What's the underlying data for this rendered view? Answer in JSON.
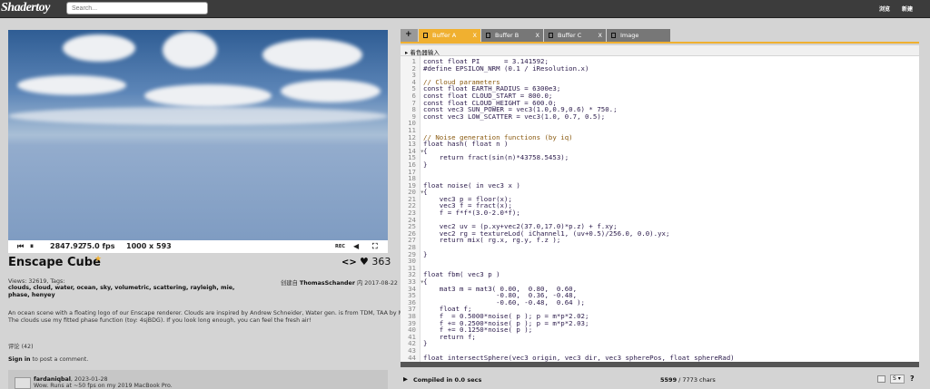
{
  "header": {
    "logo": "Shadertoy",
    "search_placeholder": "Search...",
    "nav": [
      "浏览",
      "新建"
    ]
  },
  "player": {
    "time": "2847.92",
    "fps": "75.0 fps",
    "resolution": "1000 x 593",
    "rec": "REC"
  },
  "shader": {
    "title": "Enscape Cube",
    "likes": "363",
    "views": "Views: 32619, Tags:",
    "tags": "clouds, cloud, water, ocean, sky, volumetric, scattering, rayleigh, mie, phase, henyey",
    "created_prefix": "创建自",
    "author": "ThomasSchander",
    "created_suffix": "内 2017-08-22",
    "description1": "An ocean scene with a floating logo of our Enscape renderer. Clouds are inspired by Andrew Schneider, Water gen. is from TDM, TAA by Marco Salvi.",
    "description2": "The clouds use my fitted phase function (toy: 4sjBDG). If you look long enough, you can feel the fresh air!"
  },
  "comments": {
    "count_label": "评论 (42)",
    "sign_in": "Sign in",
    "sign_in_suffix": " to post a comment.",
    "items": [
      {
        "user": "fardaniqbal",
        "date": ", 2023-01-28",
        "text": "Wow. Runs at ~50 fps on my 2019 MacBook Pro."
      }
    ]
  },
  "editor": {
    "tabs": [
      {
        "label": "Buffer A",
        "active": true
      },
      {
        "label": "Buffer B"
      },
      {
        "label": "Buffer C"
      },
      {
        "label": "Image"
      }
    ],
    "close": "X",
    "add": "+",
    "inputs_label": "着色器输入",
    "lines": [
      "const float PI      = 3.141592;",
      "#define EPSILON_NRM (0.1 / iResolution.x)",
      "",
      "// Cloud parameters",
      "const float EARTH_RADIUS = 6300e3;",
      "const float CLOUD_START = 800.0;",
      "const float CLOUD_HEIGHT = 600.0;",
      "const vec3 SUN_POWER = vec3(1.0,0.9,0.6) * 750.;",
      "const vec3 LOW_SCATTER = vec3(1.0, 0.7, 0.5);",
      "",
      "",
      "// Noise generation functions (by iq)",
      "float hash( float n )",
      "{",
      "    return fract(sin(n)*43758.5453);",
      "}",
      "",
      "",
      "float noise( in vec3 x )",
      "{",
      "    vec3 p = floor(x);",
      "    vec3 f = fract(x);",
      "    f = f*f*(3.0-2.0*f);",
      "",
      "    vec2 uv = (p.xy+vec2(37.0,17.0)*p.z) + f.xy;",
      "    vec2 rg = textureLod( iChannel1, (uv+0.5)/256.0, 0.0).yx;",
      "    return mix( rg.x, rg.y, f.z );",
      "",
      "}",
      "",
      "",
      "float fbm( vec3 p )",
      "{",
      "    mat3 m = mat3( 0.00,  0.80,  0.60,",
      "                  -0.80,  0.36, -0.48,",
      "                  -0.60, -0.48,  0.64 );",
      "    float f;",
      "    f  = 0.5000*noise( p ); p = m*p*2.02;",
      "    f += 0.2500*noise( p ); p = m*p*2.03;",
      "    f += 0.1250*noise( p );",
      "    return f;",
      "}",
      "",
      "float intersectSphere(vec3 origin, vec3 dir, vec3 spherePos, float sphereRad)"
    ],
    "folds": [
      14,
      20,
      33,
      45
    ],
    "status": "Compiled in 0.0 secs",
    "chars": "5599",
    "chars_total": " / 7773 chars",
    "font_select": "S",
    "help": "?"
  }
}
